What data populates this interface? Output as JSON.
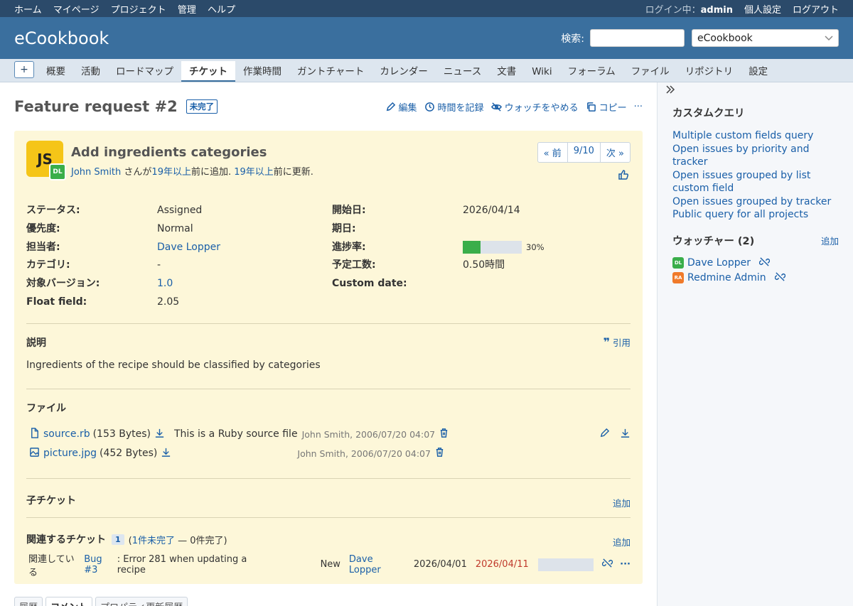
{
  "top_menu": {
    "items": [
      "ホーム",
      "マイページ",
      "プロジェクト",
      "管理",
      "ヘルプ"
    ],
    "logged_in_label": "ログイン中：",
    "user": "admin",
    "my_account": "個人設定",
    "logout": "ログアウト"
  },
  "header": {
    "title": "eCookbook",
    "search_label": "検索:",
    "search_value": "",
    "project_select": "eCookbook"
  },
  "main_menu": {
    "new_button": "+",
    "tabs": [
      "概要",
      "活動",
      "ロードマップ",
      "チケット",
      "作業時間",
      "ガントチャート",
      "カレンダー",
      "ニュース",
      "文書",
      "Wiki",
      "フォーラム",
      "ファイル",
      "リポジトリ",
      "設定"
    ],
    "selected": "チケット"
  },
  "issue": {
    "title": "Feature request #2",
    "status_badge": "未完了",
    "actions": {
      "edit": "編集",
      "log_time": "時間を記録",
      "unwatch": "ウォッチをやめる",
      "copy": "コピー",
      "more": "···"
    },
    "author_avatar": "JS",
    "assignee_avatar": "DL",
    "subject": "Add ingredients categories",
    "author_name": "John Smith",
    "author_mid": "さんが",
    "added_ago": "19年以上",
    "added_suffix": "前に追加.",
    "updated_ago": "19年以上",
    "updated_suffix": "前に更新.",
    "nav": {
      "prev": "« 前",
      "position": "9/10",
      "next": "次 »"
    },
    "attributes_left": [
      {
        "label": "ステータス:",
        "value": "Assigned",
        "link": false
      },
      {
        "label": "優先度:",
        "value": "Normal",
        "link": false
      },
      {
        "label": "担当者:",
        "value": "Dave Lopper",
        "link": true
      },
      {
        "label": "カテゴリ:",
        "value": "-",
        "link": false
      },
      {
        "label": "対象バージョン:",
        "value": "1.0",
        "link": true
      },
      {
        "label": "Float field:",
        "value": "2.05",
        "link": false
      }
    ],
    "attributes_right": [
      {
        "label": "開始日:",
        "value": "2026/04/14"
      },
      {
        "label": "期日:",
        "value": ""
      },
      {
        "label": "進捗率:",
        "value": "30%"
      },
      {
        "label": "予定工数:",
        "value": "0.50時間"
      },
      {
        "label": "Custom date:",
        "value": ""
      }
    ],
    "progress_fraction": 0.3,
    "description_heading": "説明",
    "quote_label": "引用",
    "description": "Ingredients of the recipe should be classified by categories",
    "files_heading": "ファイル",
    "files": [
      {
        "name": "source.rb",
        "size": "(153 Bytes)",
        "description": "This is a Ruby source file",
        "meta": "John Smith, 2006/07/20 04:07",
        "icon": "file-icon"
      },
      {
        "name": "picture.jpg",
        "size": "(452 Bytes)",
        "description": "",
        "meta": "John Smith, 2006/07/20 04:07",
        "icon": "image-icon"
      }
    ],
    "subtasks_heading": "子チケット",
    "subtasks_add": "追加",
    "relations_heading": "関連するチケット",
    "relations_count": "1",
    "relations_open_link": "1件未完了",
    "relations_summary_pre": "(",
    "relations_summary_post": " — 0件完了)",
    "relations_add": "追加",
    "relations": [
      {
        "type": "関連している",
        "issue_link": "Bug #3",
        "subject": ": Error 281 when updating a recipe",
        "status": "New",
        "assignee": "Dave Lopper",
        "start": "2026/04/01",
        "due": "2026/04/11"
      }
    ],
    "bottom_tabs": [
      "履歴",
      "コメント",
      "プロパティ更新履歴"
    ],
    "bottom_selected": "コメント"
  },
  "sidebar": {
    "queries_heading": "カスタムクエリ",
    "queries": [
      "Multiple custom fields query",
      "Open issues by priority and tracker",
      "Open issues grouped by list custom field",
      "Open issues grouped by tracker",
      "Public query for all projects"
    ],
    "watchers_heading": "ウォッチャー (2)",
    "watchers_add": "追加",
    "watchers": [
      {
        "initials": "DL",
        "name": "Dave Lopper",
        "color": "#3aae4a"
      },
      {
        "initials": "RA",
        "name": "Redmine Admin",
        "color": "#f07a2a"
      }
    ]
  },
  "colors": {
    "top_bar": "#2b4a6a",
    "header": "#3a6f9e",
    "menu": "#dde6ef",
    "issue_bg": "#fdf7d9",
    "link": "#1a5fa8",
    "progress": "#3aae4a",
    "overdue": "#c0392b"
  }
}
